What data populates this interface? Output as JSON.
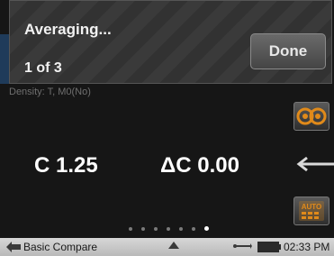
{
  "overlay": {
    "title": "Averaging...",
    "progress": "1 of 3",
    "done_label": "Done"
  },
  "background": {
    "density_text": "Density: T, M0(No)"
  },
  "measurement": {
    "c_value": "C 1.25",
    "delta_c_value": "ΔC 0.00"
  },
  "icons": {
    "compare": "compare-icon",
    "auto": "auto-icon",
    "auto_label": "AUTO",
    "arrow": "left-arrow-icon"
  },
  "pager": {
    "page_count": 7,
    "active_index": 6
  },
  "statusbar": {
    "title": "Basic Compare",
    "time": "02:33 PM"
  },
  "colors": {
    "accent_orange": "#e08a1a",
    "background": "#161616",
    "statusbar": "#c9c9c9"
  }
}
